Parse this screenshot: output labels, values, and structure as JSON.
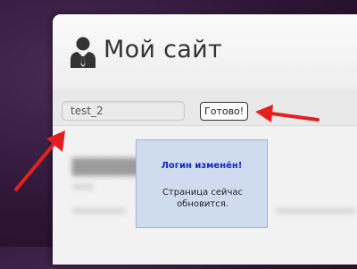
{
  "header": {
    "site_title": "Мой сайт",
    "icon": "user-tie-icon"
  },
  "toolbar": {
    "name_value": "test_2",
    "done_label": "Готово!"
  },
  "popup": {
    "title": "Логин изменён!",
    "message": "Страница сейчас обновится."
  },
  "colors": {
    "background": "#2e1636",
    "card": "#f2f2f2",
    "popup_bg": "#cfdcef",
    "popup_title": "#0f2ac0",
    "arrow": "#e32020"
  }
}
